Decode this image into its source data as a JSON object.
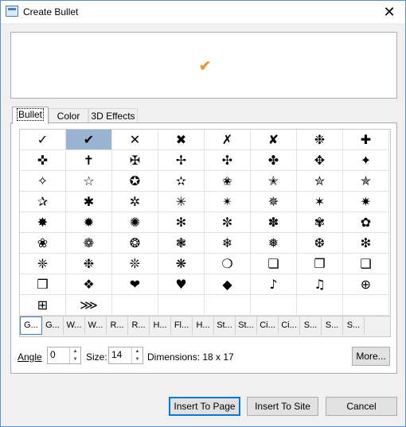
{
  "window": {
    "title": "Create Bullet"
  },
  "preview": {
    "glyph": "✔",
    "color": "#e8982c"
  },
  "tabs": [
    "Bullet",
    "Color",
    "3D Effects"
  ],
  "symbols": [
    "✓",
    "✔",
    "✕",
    "✖",
    "✗",
    "✘",
    "❉",
    "✚",
    "✜",
    "✝",
    "✠",
    "✢",
    "✣",
    "✤",
    "✥",
    "✦",
    "✧",
    "☆",
    "✪",
    "✫",
    "✬",
    "✭",
    "✮",
    "✯",
    "✰",
    "✱",
    "✲",
    "✳",
    "✴",
    "✵",
    "✶",
    "✷",
    "✸",
    "✹",
    "✺",
    "✻",
    "✼",
    "✽",
    "✾",
    "✿",
    "❀",
    "❁",
    "❂",
    "❃",
    "❄",
    "❅",
    "❆",
    "❇",
    "❈",
    "❉",
    "❊",
    "❋",
    "❍",
    "❏",
    "❐",
    "❑",
    "❒",
    "❖",
    "❤",
    "♥",
    "◆",
    "♪",
    "♫",
    "⊕",
    "⊞",
    "⋙"
  ],
  "font_tabs": [
    "G...",
    "G...",
    "W...",
    "W...",
    "R...",
    "R...",
    "H...",
    "Fl...",
    "H...",
    "St...",
    "St...",
    "Ci...",
    "Ci...",
    "S...",
    "S...",
    "S..."
  ],
  "angle": {
    "label": "Angle",
    "value": "0"
  },
  "size": {
    "label": "Size:",
    "value": "14"
  },
  "dimensions": "Dimensions: 18 x 17",
  "buttons": {
    "more": "More...",
    "insert_page": "Insert To Page",
    "insert_site": "Insert To Site",
    "cancel": "Cancel"
  }
}
